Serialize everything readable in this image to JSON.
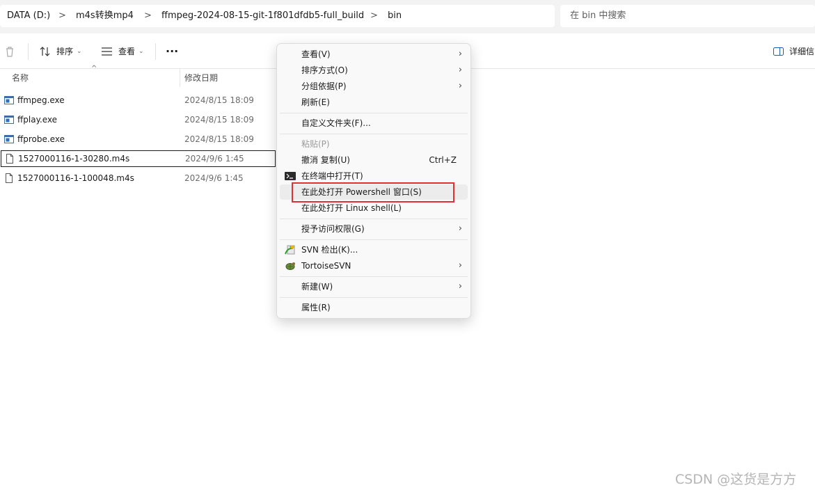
{
  "breadcrumb": {
    "items": [
      "DATA (D:)",
      "m4s转换mp4",
      "ffmpeg-2024-08-15-git-1f801dfdb5-full_build",
      "bin"
    ],
    "separator": ">"
  },
  "search": {
    "placeholder": "在 bin 中搜索"
  },
  "commandbar": {
    "sort_label": "排序",
    "view_label": "查看",
    "more_label": "···",
    "details_label": "详细信"
  },
  "columns": {
    "name": "名称",
    "modified": "修改日期"
  },
  "files": [
    {
      "name": "ffmpeg.exe",
      "date": "2024/8/15 18:09",
      "icon": "exe-icon"
    },
    {
      "name": "ffplay.exe",
      "date": "2024/8/15 18:09",
      "icon": "exe-icon"
    },
    {
      "name": "ffprobe.exe",
      "date": "2024/8/15 18:09",
      "icon": "exe-icon"
    },
    {
      "name": "1527000116-1-30280.m4s",
      "date": "2024/9/6 1:45",
      "icon": "file-icon"
    },
    {
      "name": "1527000116-1-100048.m4s",
      "date": "2024/9/6 1:45",
      "icon": "file-icon"
    }
  ],
  "context_menu": {
    "view": "查看(V)",
    "sort_by": "排序方式(O)",
    "group_by": "分组依据(P)",
    "refresh": "刷新(E)",
    "customize": "自定义文件夹(F)...",
    "paste": "粘贴(P)",
    "undo": "撤消 复制(U)",
    "undo_shortcut": "Ctrl+Z",
    "open_terminal": "在终端中打开(T)",
    "open_powershell": "在此处打开 Powershell 窗口(S)",
    "open_linux": "在此处打开 Linux shell(L)",
    "grant_access": "授予访问权限(G)",
    "svn_checkout": "SVN 检出(K)...",
    "tortoise": "TortoiseSVN",
    "new": "新建(W)",
    "properties": "属性(R)"
  },
  "watermark": "CSDN @这货是方方",
  "colors": {
    "highlight_border": "#e03030",
    "menu_bg": "#f9f9f9"
  }
}
